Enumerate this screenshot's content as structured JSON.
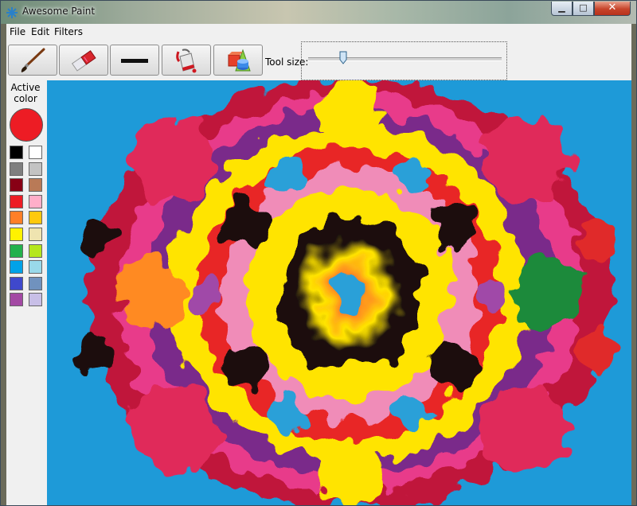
{
  "window": {
    "title": "Awesome Paint"
  },
  "menu": {
    "items": [
      "File",
      "Edit",
      "Filters"
    ]
  },
  "toolbar": {
    "tools": [
      {
        "name": "brush-tool-button",
        "icon": "paintbrush-icon"
      },
      {
        "name": "eraser-tool-button",
        "icon": "eraser-icon"
      },
      {
        "name": "line-tool-button",
        "icon": "line-icon"
      },
      {
        "name": "fill-tool-button",
        "icon": "paint-bucket-icon"
      },
      {
        "name": "shapes-tool-button",
        "icon": "shapes-icon"
      }
    ],
    "tool_size_label": "Tool size:",
    "tool_size_fraction": 0.18
  },
  "palette": {
    "active_label": "Active color",
    "active_color": "#ed1c24",
    "colors": [
      "#000000",
      "#ffffff",
      "#7f7f7f",
      "#c3c3c3",
      "#880015",
      "#b97a57",
      "#ed1c24",
      "#ffaec9",
      "#ff7f27",
      "#ffc90e",
      "#fff200",
      "#efe4b0",
      "#22b14c",
      "#b5e61d",
      "#00a2e8",
      "#99d9ea",
      "#3f48cc",
      "#7092be",
      "#a349a4",
      "#c8bfe7"
    ]
  }
}
